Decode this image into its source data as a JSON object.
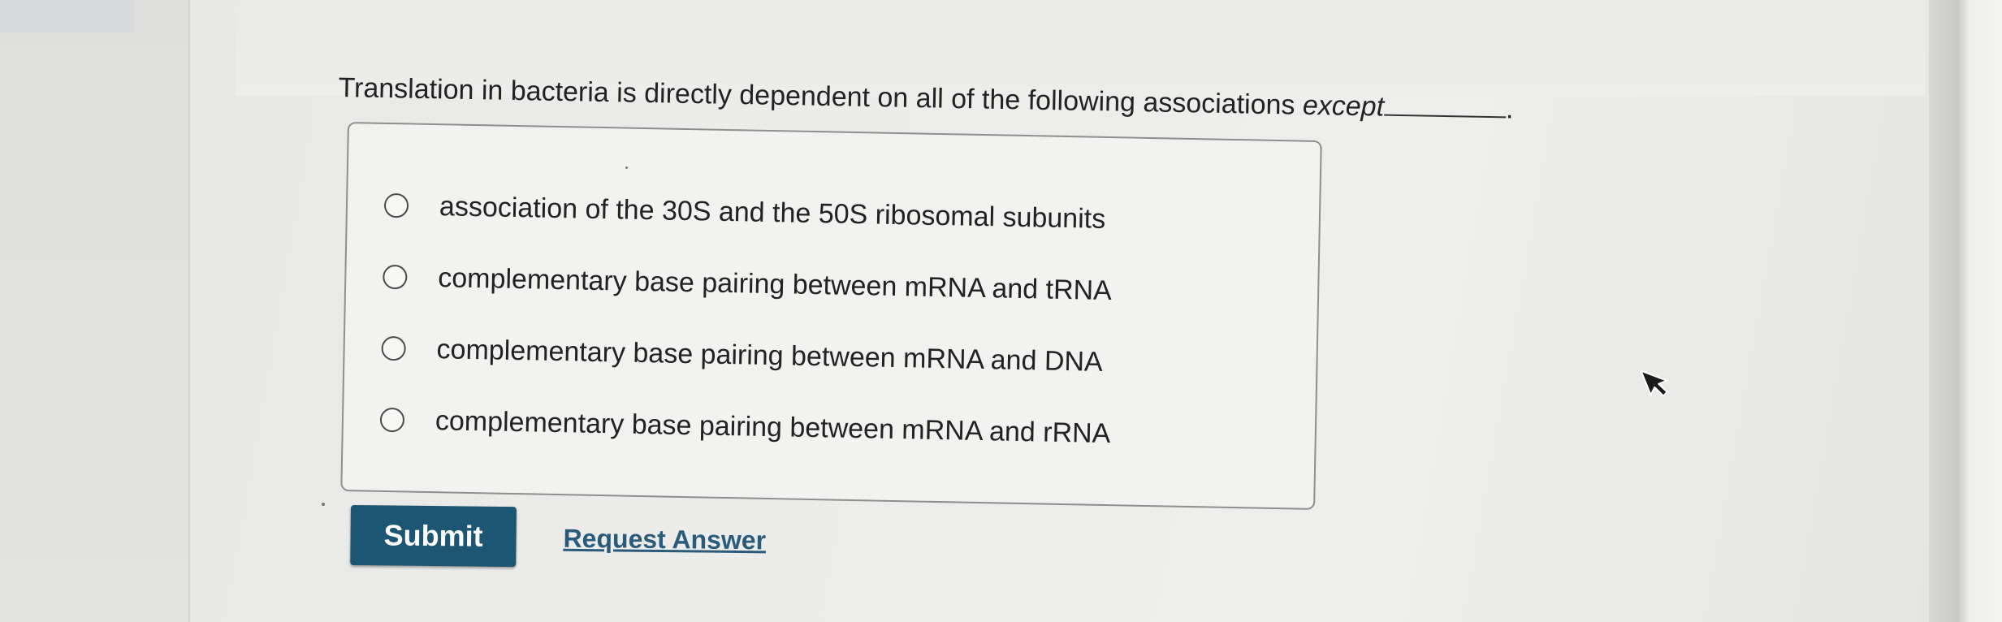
{
  "question": {
    "text_before": "Translation in bacteria is directly dependent on all of the following associations ",
    "emphasis": "except",
    "text_after": "."
  },
  "choices": [
    {
      "label": "association of the 30S and the 50S ribosomal subunits",
      "selected": false
    },
    {
      "label": "complementary base pairing between mRNA and tRNA",
      "selected": false
    },
    {
      "label": "complementary base pairing between mRNA and DNA",
      "selected": false
    },
    {
      "label": "complementary base pairing between mRNA and rRNA",
      "selected": false
    }
  ],
  "actions": {
    "submit_label": "Submit",
    "request_answer_label": "Request Answer"
  },
  "colors": {
    "submit_background": "#1d5672",
    "link": "#2a5b7a"
  },
  "icons": {
    "cursor": "mouse-pointer-icon",
    "radio": "radio-button-icon"
  }
}
